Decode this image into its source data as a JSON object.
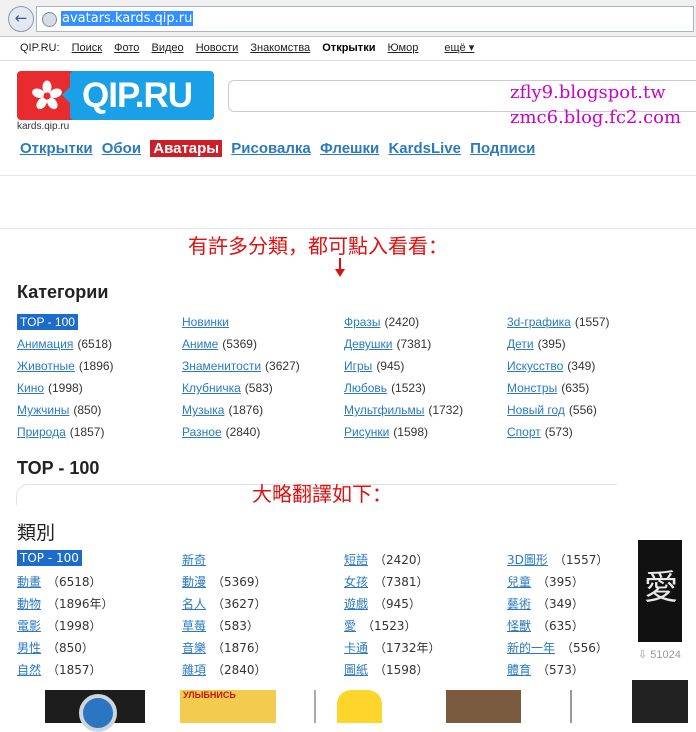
{
  "browser": {
    "url": "avatars.kards.qip.ru"
  },
  "top_nav": {
    "items": [
      "QIP.RU:",
      "Поиск",
      "Фото",
      "Видео",
      "Новости",
      "Знакомства",
      "Открытки",
      "Юмор"
    ],
    "more_label": "ещё ▾"
  },
  "logo": {
    "brand": "QIP.RU",
    "sublabel": "kards.qip.ru"
  },
  "watermarks": [
    "zfly9.blogspot.tw",
    "zmc6.blog.fc2.com"
  ],
  "tabs": [
    "Открытки",
    "Обои",
    "Аватары",
    "Рисовалка",
    "Флешки",
    "KardsLive",
    "Подписи"
  ],
  "notes": {
    "categories_note": "有許多分類，都可點入看看：",
    "translation_note": "大略翻譯如下："
  },
  "categories_ru": {
    "heading": "Категории",
    "columns": [
      [
        {
          "name": "TOP - 100",
          "count": ""
        },
        {
          "name": "Анимация",
          "count": "(6518)"
        },
        {
          "name": "Животные",
          "count": "(1896)"
        },
        {
          "name": "Кино",
          "count": "(1998)"
        },
        {
          "name": "Мужчины",
          "count": "(850)"
        },
        {
          "name": "Природа",
          "count": "(1857)"
        }
      ],
      [
        {
          "name": "Новинки",
          "count": ""
        },
        {
          "name": "Аниме",
          "count": "(5369)"
        },
        {
          "name": "Знаменитости",
          "count": "(3627)"
        },
        {
          "name": "Клубничка",
          "count": "(583)"
        },
        {
          "name": "Музыка",
          "count": "(1876)"
        },
        {
          "name": "Разное",
          "count": "(2840)"
        }
      ],
      [
        {
          "name": "Фразы",
          "count": "(2420)"
        },
        {
          "name": "Девушки",
          "count": "(7381)"
        },
        {
          "name": "Игры",
          "count": "(945)"
        },
        {
          "name": "Любовь",
          "count": "(1523)"
        },
        {
          "name": "Мультфильмы",
          "count": "(1732)"
        },
        {
          "name": "Рисунки",
          "count": "(1598)"
        }
      ],
      [
        {
          "name": "3d-графика",
          "count": "(1557)"
        },
        {
          "name": "Дети",
          "count": "(395)"
        },
        {
          "name": "Искусство",
          "count": "(349)"
        },
        {
          "name": "Монстры",
          "count": "(635)"
        },
        {
          "name": "Новый год",
          "count": "(556)"
        },
        {
          "name": "Спорт",
          "count": "(573)"
        }
      ]
    ]
  },
  "top100_heading": "TOP - 100",
  "categories_zh": {
    "heading": "類別",
    "columns": [
      [
        {
          "name": "TOP - 100",
          "count": ""
        },
        {
          "name": "動畫",
          "count": "（6518）"
        },
        {
          "name": "動物",
          "count": "（1896年）"
        },
        {
          "name": "電影",
          "count": "（1998）"
        },
        {
          "name": "男性",
          "count": "（850）"
        },
        {
          "name": "自然",
          "count": "（1857）"
        }
      ],
      [
        {
          "name": "新奇",
          "count": ""
        },
        {
          "name": "動漫",
          "count": "（5369）"
        },
        {
          "name": "名人",
          "count": "（3627）"
        },
        {
          "name": "草莓",
          "count": "（583）"
        },
        {
          "name": "音樂",
          "count": "（1876）"
        },
        {
          "name": "雜項",
          "count": "（2840）"
        }
      ],
      [
        {
          "name": "短語",
          "count": "（2420）"
        },
        {
          "name": "女孩",
          "count": "（7381）"
        },
        {
          "name": "遊戲",
          "count": "（945）"
        },
        {
          "name": "愛",
          "count": "（1523）"
        },
        {
          "name": "卡通",
          "count": "（1732年）"
        },
        {
          "name": "圖紙",
          "count": "（1598）"
        }
      ],
      [
        {
          "name": "3D圖形",
          "count": "（1557）"
        },
        {
          "name": "兒童",
          "count": "（395）"
        },
        {
          "name": "藝術",
          "count": "（349）"
        },
        {
          "name": "怪獸",
          "count": "（635）"
        },
        {
          "name": "新的一年",
          "count": "（556）"
        },
        {
          "name": "體育",
          "count": "（573）"
        }
      ]
    ]
  },
  "side_thumb": {
    "glyph": "愛",
    "downloads": "⇩ 51024"
  },
  "bottom_strip": {
    "banner_text": "УЛЫБНИСЬ"
  }
}
